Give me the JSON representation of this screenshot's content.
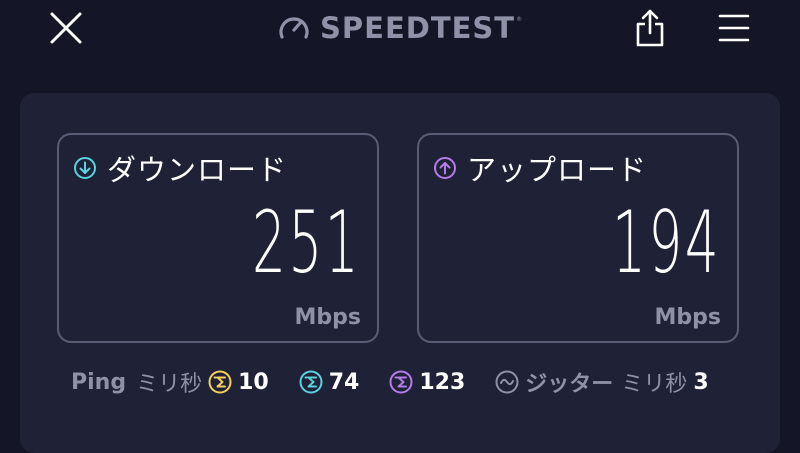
{
  "header": {
    "close_icon": "close-icon",
    "brand_text": "SPEEDTEST",
    "brand_mark": "®",
    "logo_icon": "speedometer-icon",
    "share_icon": "share-icon",
    "menu_icon": "hamburger-menu-icon"
  },
  "results": {
    "download": {
      "label": "ダウンロード",
      "value": "251",
      "unit": "Mbps",
      "icon": "download-arrow-icon",
      "color": "#58d3de"
    },
    "upload": {
      "label": "アップロード",
      "value": "194",
      "unit": "Mbps",
      "icon": "upload-arrow-icon",
      "color": "#b37de8"
    }
  },
  "ping": {
    "label": "Ping",
    "unit": "ミリ秒",
    "idle": {
      "value": "10",
      "color": "#f5cf58",
      "icon": "ping-idle-icon"
    },
    "download": {
      "value": "74",
      "color": "#58d3de",
      "icon": "ping-download-icon"
    },
    "upload": {
      "value": "123",
      "color": "#b37de8",
      "icon": "ping-upload-icon"
    },
    "jitter": {
      "label": "ジッター",
      "unit": "ミリ秒",
      "value": "3",
      "color": "#8f91a8",
      "icon": "jitter-wave-icon"
    }
  },
  "colors": {
    "background": "#141526",
    "panel": "#1f2136",
    "border": "#5a5c75",
    "muted_text": "#8f91a8"
  }
}
